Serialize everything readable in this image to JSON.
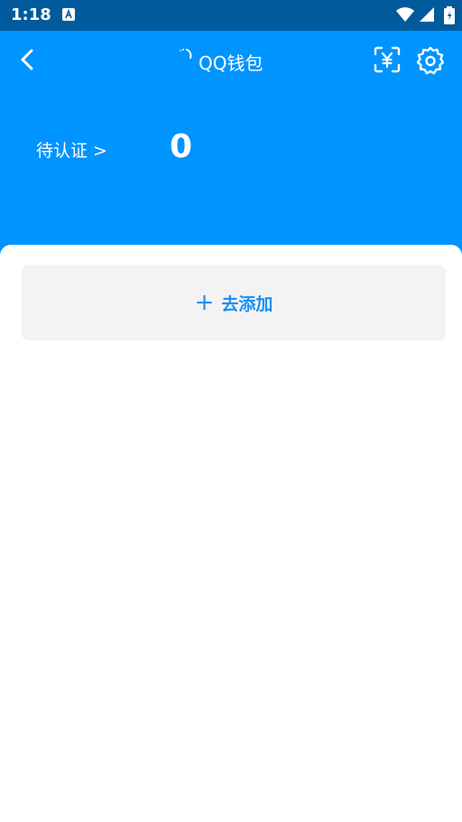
{
  "status_bar": {
    "time": "1:18"
  },
  "header": {
    "title": "QQ钱包",
    "pending_label": "待认证 >",
    "pending_count": "0",
    "color": "#0094ff"
  },
  "content": {
    "add_plus": "+",
    "add_label": "去添加",
    "accent": "#1a8ff0"
  },
  "icons": [
    "back-arrow-icon",
    "loading-spinner-icon",
    "yuan-scan-icon",
    "gear-icon",
    "wifi-icon",
    "signal-icon",
    "battery-icon"
  ]
}
